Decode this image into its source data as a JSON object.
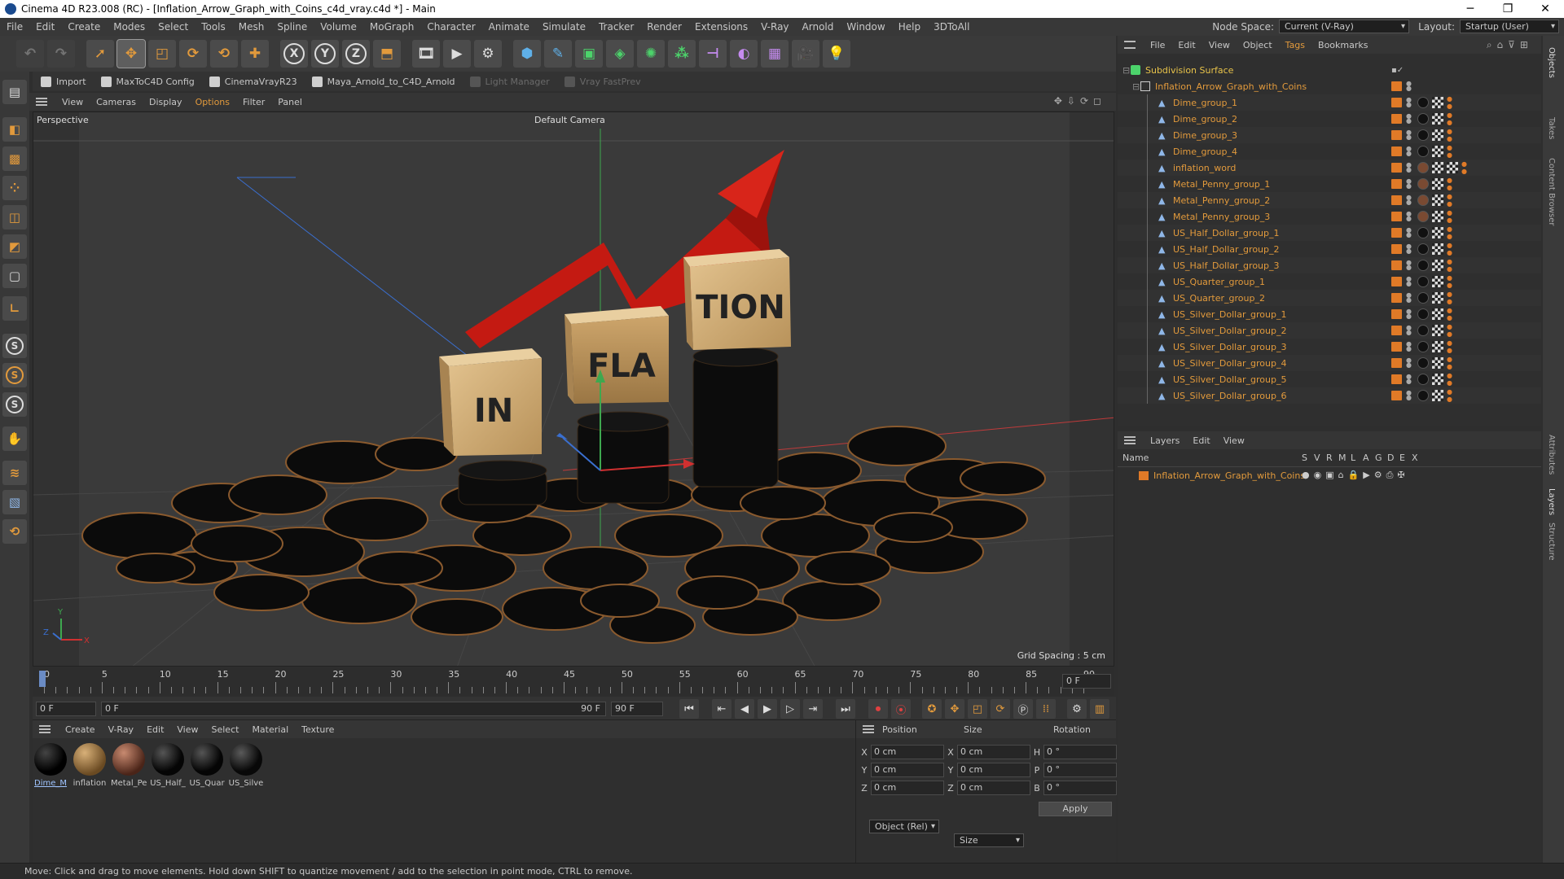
{
  "window": {
    "title": "Cinema 4D R23.008 (RC) - [Inflation_Arrow_Graph_with_Coins_c4d_vray.c4d *] - Main",
    "minimize": "─",
    "maximize": "❐",
    "close": "✕"
  },
  "menu": {
    "items": [
      "File",
      "Edit",
      "Create",
      "Modes",
      "Select",
      "Tools",
      "Mesh",
      "Spline",
      "Volume",
      "MoGraph",
      "Character",
      "Animate",
      "Simulate",
      "Tracker",
      "Render",
      "Extensions",
      "V-Ray",
      "Arnold",
      "Window",
      "Help",
      "3DToAll"
    ],
    "node_space_label": "Node Space:",
    "node_space_value": "Current (V-Ray)",
    "layout_label": "Layout:",
    "layout_value": "Startup (User)"
  },
  "plugins": {
    "items": [
      "Import",
      "MaxToC4D Config",
      "CinemaVrayR23",
      "Maya_Arnold_to_C4D_Arnold",
      "Light Manager",
      "Vray FastPrev"
    ]
  },
  "viewport": {
    "menu": [
      "View",
      "Cameras",
      "Display",
      "Options",
      "Filter",
      "Panel"
    ],
    "label": "Perspective",
    "camera": "Default Camera",
    "grid_spacing": "Grid Spacing : 5 cm",
    "cube_texts": [
      "IN",
      "FLA",
      "TION"
    ],
    "axis": {
      "x": "X",
      "y": "Y",
      "z": "Z"
    }
  },
  "timeline": {
    "ticks": [
      "0",
      "5",
      "10",
      "15",
      "20",
      "25",
      "30",
      "35",
      "40",
      "45",
      "50",
      "55",
      "60",
      "65",
      "70",
      "75",
      "80",
      "85",
      "90"
    ],
    "end_field": "0 F"
  },
  "transport": {
    "start": "0 F",
    "current": "0 F",
    "end_inner": "90 F",
    "end": "90 F"
  },
  "materials": {
    "menu": [
      "Create",
      "V-Ray",
      "Edit",
      "View",
      "Select",
      "Material",
      "Texture"
    ],
    "items": [
      {
        "label": "Dime_M",
        "color": "#0a0a0a"
      },
      {
        "label": "inflation",
        "color": "#8a6a3c"
      },
      {
        "label": "Metal_Pe",
        "color": "#7a4a38"
      },
      {
        "label": "US_Half_",
        "color": "#0d0d0d"
      },
      {
        "label": "US_Quar",
        "color": "#0d0d0d"
      },
      {
        "label": "US_Silve",
        "color": "#111111"
      }
    ]
  },
  "coords": {
    "headers": [
      "Position",
      "Size",
      "Rotation"
    ],
    "rows": [
      {
        "a": "X",
        "pos": "0 cm",
        "b": "X",
        "size": "0 cm",
        "c": "H",
        "rot": "0 °"
      },
      {
        "a": "Y",
        "pos": "0 cm",
        "b": "Y",
        "size": "0 cm",
        "c": "P",
        "rot": "0 °"
      },
      {
        "a": "Z",
        "pos": "0 cm",
        "b": "Z",
        "size": "0 cm",
        "c": "B",
        "rot": "0 °"
      }
    ],
    "mode": "Object (Rel)",
    "size_mode": "Size",
    "apply": "Apply"
  },
  "objects": {
    "menu": [
      "File",
      "Edit",
      "View",
      "Object",
      "Tags",
      "Bookmarks"
    ],
    "root": "Subdivision Surface",
    "group": "Inflation_Arrow_Graph_with_Coins",
    "children": [
      "Dime_group_1",
      "Dime_group_2",
      "Dime_group_3",
      "Dime_group_4",
      "inflation_word",
      "Metal_Penny_group_1",
      "Metal_Penny_group_2",
      "Metal_Penny_group_3",
      "US_Half_Dollar_group_1",
      "US_Half_Dollar_group_2",
      "US_Half_Dollar_group_3",
      "US_Quarter_group_1",
      "US_Quarter_group_2",
      "US_Silver_Dollar_group_1",
      "US_Silver_Dollar_group_2",
      "US_Silver_Dollar_group_3",
      "US_Silver_Dollar_group_4",
      "US_Silver_Dollar_group_5",
      "US_Silver_Dollar_group_6"
    ]
  },
  "layers": {
    "menu": [
      "Layers",
      "Edit",
      "View"
    ],
    "col_name": "Name",
    "cols": [
      "S",
      "V",
      "R",
      "M",
      "L",
      "A",
      "G",
      "D",
      "E",
      "X"
    ],
    "rows": [
      "Inflation_Arrow_Graph_with_Coins"
    ]
  },
  "right_tabs": [
    "Objects",
    "Takes",
    "Content Browser",
    "Attributes",
    "Layers",
    "Structure"
  ],
  "status": "Move: Click and drag to move elements. Hold down SHIFT to quantize movement / add to the selection in point mode, CTRL to remove.",
  "colors": {
    "accent": "#e29a3c",
    "tag": "#e07a27",
    "arrow": "#c41a12"
  }
}
